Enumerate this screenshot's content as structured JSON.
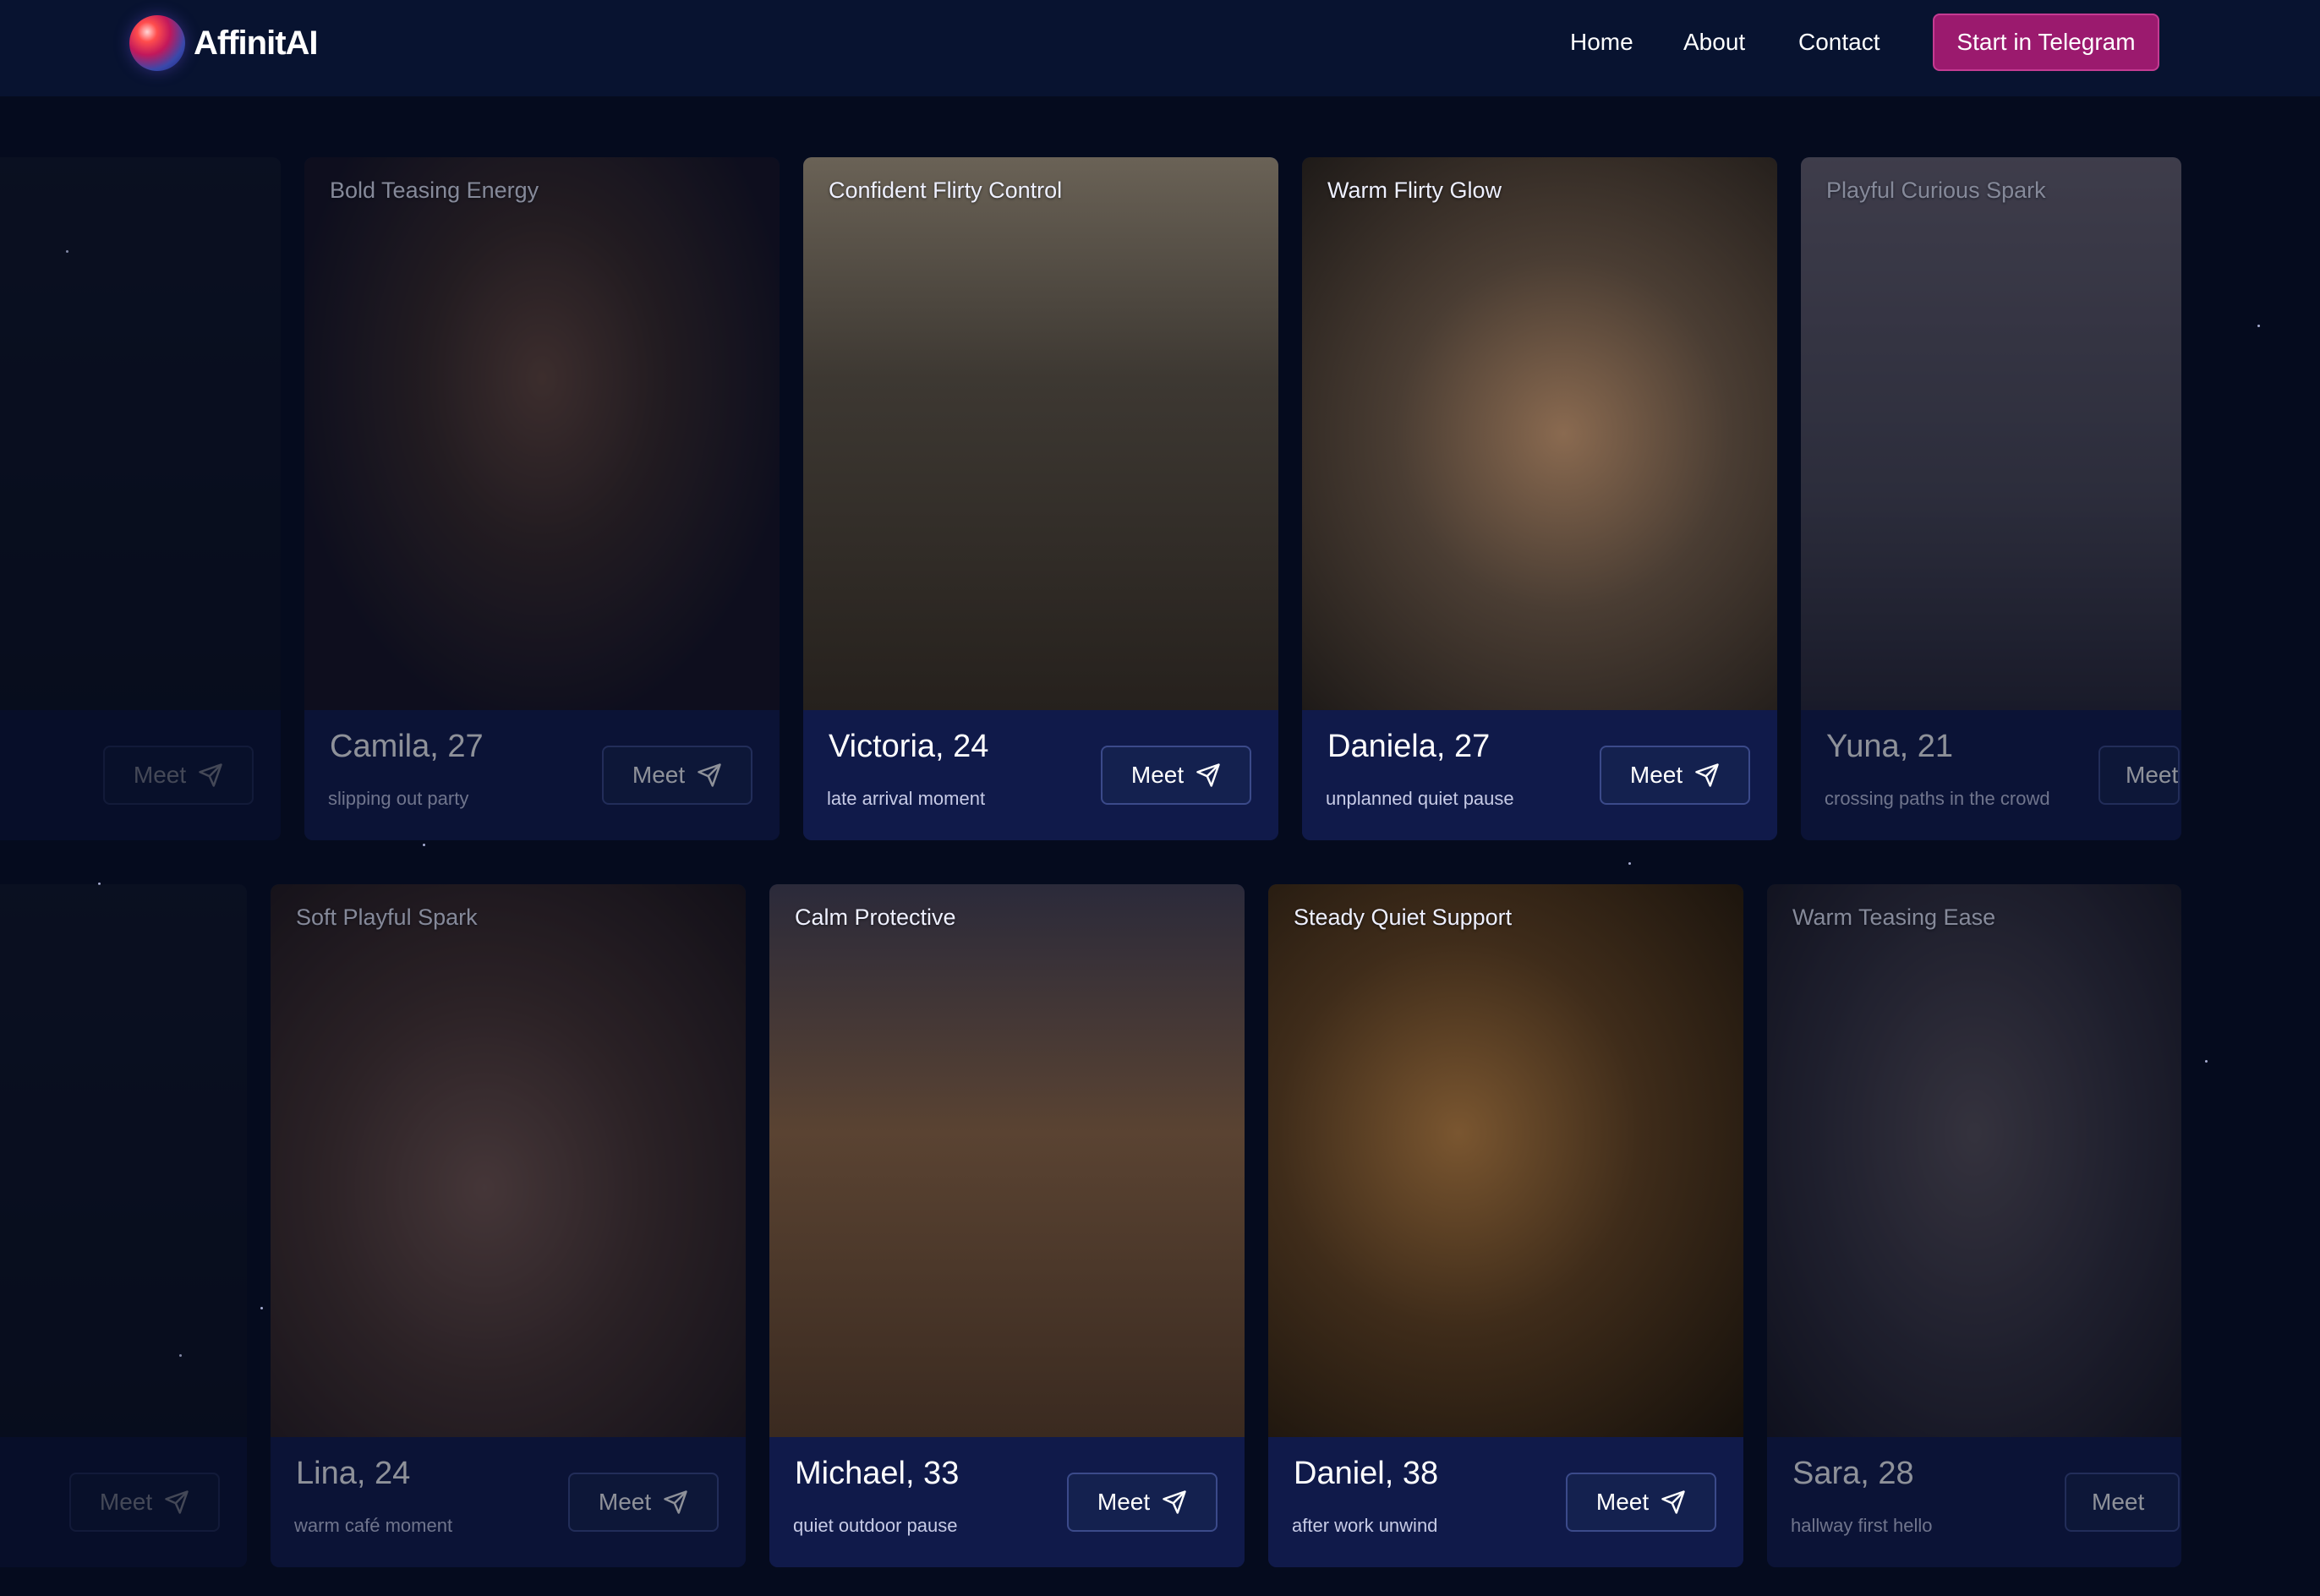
{
  "brand": {
    "name": "AffinitAI"
  },
  "nav": {
    "home": "Home",
    "about": "About",
    "contact": "Contact",
    "cta": "Start in Telegram"
  },
  "meet_label": "Meet",
  "row1": [
    {
      "vibe": "",
      "name": "",
      "moment": ""
    },
    {
      "vibe": "Bold Teasing Energy",
      "name": "Camila, 27",
      "moment": "slipping out party"
    },
    {
      "vibe": "Confident Flirty Control",
      "name": "Victoria, 24",
      "moment": "late arrival moment"
    },
    {
      "vibe": "Warm Flirty Glow",
      "name": "Daniela, 27",
      "moment": "unplanned quiet pause"
    },
    {
      "vibe": "Playful Curious Spark",
      "name": "Yuna, 21",
      "moment": "crossing paths in the crowd"
    }
  ],
  "row2": [
    {
      "vibe": "",
      "name": "",
      "moment": ""
    },
    {
      "vibe": "Soft Playful Spark",
      "name": "Lina, 24",
      "moment": "warm café moment"
    },
    {
      "vibe": "Calm Protective",
      "name": "Michael, 33",
      "moment": "quiet outdoor pause"
    },
    {
      "vibe": "Steady Quiet Support",
      "name": "Daniel, 38",
      "moment": "after work unwind"
    },
    {
      "vibe": "Warm Teasing Ease",
      "name": "Sara, 28",
      "moment": "hallway first hello"
    }
  ],
  "colors": {
    "background": "#050b1e",
    "header": "#081330",
    "card_footer": "#101a4a",
    "cta": "#9b1a6e"
  }
}
